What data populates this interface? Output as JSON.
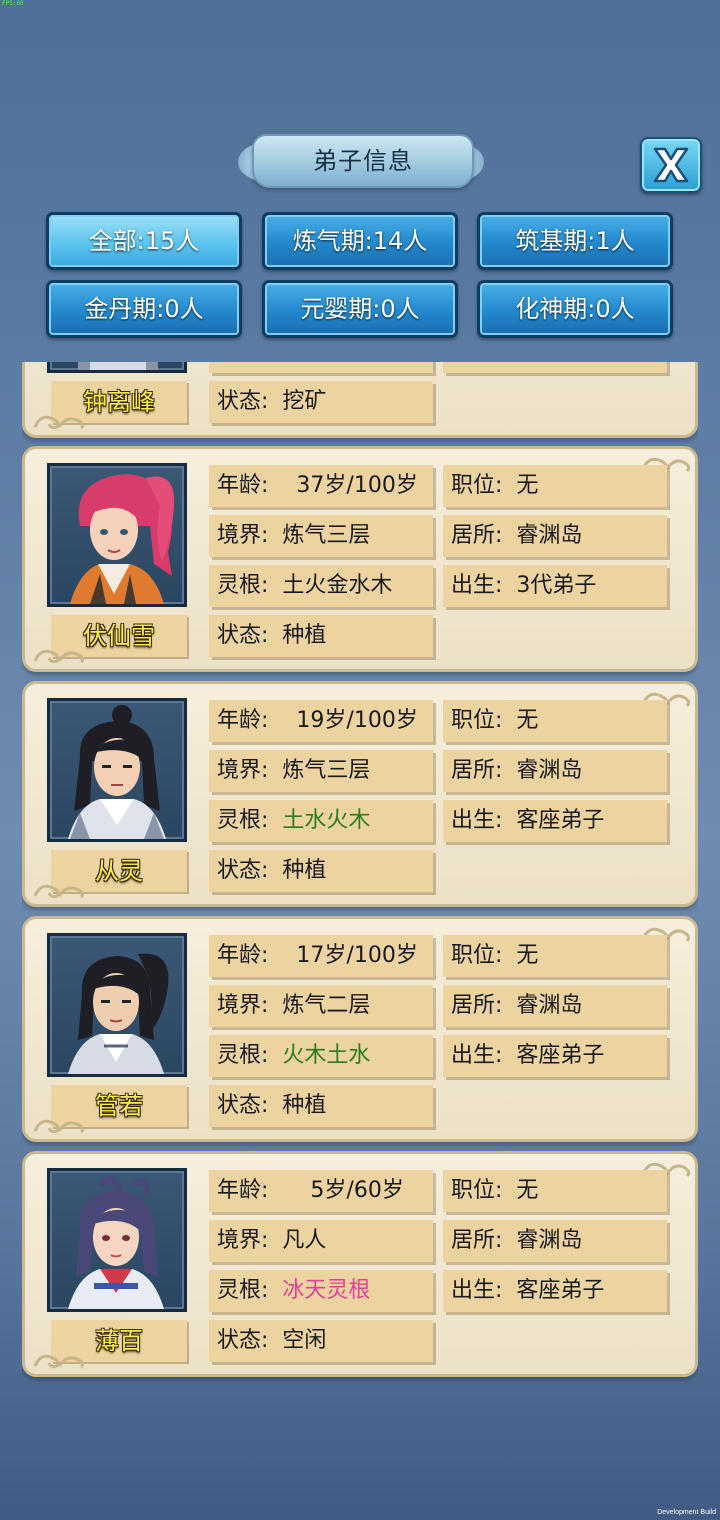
{
  "debug_mark": "FPS:60",
  "dev_build": "Development Build",
  "title": "弟子信息",
  "filters": [
    {
      "label": "全部:15人",
      "active": true
    },
    {
      "label": "炼气期:14人",
      "active": false
    },
    {
      "label": "筑基期:1人",
      "active": false
    },
    {
      "label": "金丹期:0人",
      "active": false
    },
    {
      "label": "元婴期:0人",
      "active": false
    },
    {
      "label": "化神期:0人",
      "active": false
    }
  ],
  "labels": {
    "age": "年龄:",
    "realm": "境界:",
    "root": "灵根:",
    "status": "状态:",
    "position": "职位:",
    "residence": "居所:",
    "birth": "出生:"
  },
  "colors": {
    "root_normal": "#1a1a1a",
    "root_green": "#2a7d1c",
    "root_pink": "#e0429a",
    "name_yellow": "#f8f04a",
    "filter_blue": "#2388cc"
  },
  "partial_disciple": {
    "name": "钟离峰",
    "status": "挖矿"
  },
  "disciples": [
    {
      "name": "伏仙雪",
      "age": "37岁/100岁",
      "realm": "炼气三层",
      "root": "土火金水木",
      "root_color": "normal",
      "status": "种植",
      "position": "无",
      "residence": "睿渊岛",
      "birth": "3代弟子",
      "portrait_icon": "female-red-hair-portrait-icon"
    },
    {
      "name": "从灵",
      "age": "19岁/100岁",
      "realm": "炼气三层",
      "root": "土水火木",
      "root_color": "green",
      "status": "种植",
      "position": "无",
      "residence": "睿渊岛",
      "birth": "客座弟子",
      "portrait_icon": "male-topknot-portrait-icon"
    },
    {
      "name": "管若",
      "age": "17岁/100岁",
      "realm": "炼气二层",
      "root": "火木土水",
      "root_color": "green",
      "status": "种植",
      "position": "无",
      "residence": "睿渊岛",
      "birth": "客座弟子",
      "portrait_icon": "male-ponytail-portrait-icon"
    },
    {
      "name": "薄百",
      "age": "5岁/60岁",
      "realm": "凡人",
      "root": "冰天灵根",
      "root_color": "pink",
      "status": "空闲",
      "position": "无",
      "residence": "睿渊岛",
      "birth": "客座弟子",
      "portrait_icon": "female-purple-hair-portrait-icon"
    }
  ]
}
